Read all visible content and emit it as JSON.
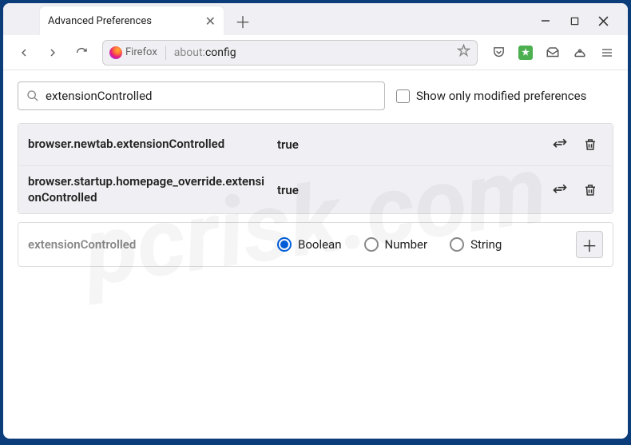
{
  "window": {
    "tab_title": "Advanced Preferences",
    "identity_label": "Firefox",
    "url_protocol": "about:",
    "url_path": "config"
  },
  "search": {
    "value": "extensionControlled",
    "checkbox_label": "Show only modified preferences"
  },
  "prefs": [
    {
      "name": "browser.newtab.extensionControlled",
      "value": "true"
    },
    {
      "name": "browser.startup.homepage_override.extensionControlled",
      "value": "true"
    }
  ],
  "new_pref": {
    "name": "extensionControlled",
    "types": [
      "Boolean",
      "Number",
      "String"
    ],
    "selected": "Boolean"
  },
  "watermark": "pcrisk.com"
}
